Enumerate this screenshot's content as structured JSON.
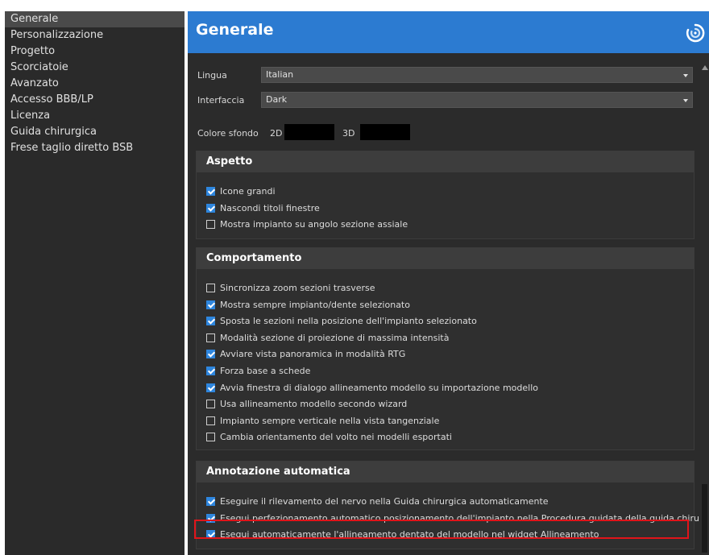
{
  "sidebar": {
    "items": [
      {
        "label": "Generale"
      },
      {
        "label": "Personalizzazione"
      },
      {
        "label": "Progetto"
      },
      {
        "label": "Scorciatoie"
      },
      {
        "label": "Avanzato"
      },
      {
        "label": "Accesso BBB/LP"
      },
      {
        "label": "Licenza"
      },
      {
        "label": "Guida chirurgica"
      },
      {
        "label": "Frese taglio diretto BSB"
      }
    ],
    "active_index": 0
  },
  "header": {
    "title": "Generale",
    "logo_icon": "swirl-logo-icon"
  },
  "settings": {
    "language_label": "Lingua",
    "language_value": "Italian",
    "interface_label": "Interfaccia",
    "interface_value": "Dark",
    "bg_color_label": "Colore sfondo",
    "bg_2d_label": "2D",
    "bg_3d_label": "3D",
    "bg_2d_color": "#000000",
    "bg_3d_color": "#000000"
  },
  "groups": {
    "aspetto": {
      "title": "Aspetto",
      "options": [
        {
          "label": "Icone grandi",
          "checked": true
        },
        {
          "label": "Nascondi titoli finestre",
          "checked": true
        },
        {
          "label": "Mostra impianto su angolo sezione assiale",
          "checked": false
        }
      ]
    },
    "comportamento": {
      "title": "Comportamento",
      "options": [
        {
          "label": "Sincronizza zoom sezioni trasverse",
          "checked": false
        },
        {
          "label": "Mostra sempre impianto/dente selezionato",
          "checked": true
        },
        {
          "label": "Sposta le sezioni nella posizione dell'impianto selezionato",
          "checked": true
        },
        {
          "label": "Modalità sezione di proiezione di massima intensità",
          "checked": false
        },
        {
          "label": "Avviare vista panoramica in modalità RTG",
          "checked": true
        },
        {
          "label": "Forza base a schede",
          "checked": true
        },
        {
          "label": "Avvia finestra di dialogo allineamento modello su importazione modello",
          "checked": true
        },
        {
          "label": "Usa allineamento modello secondo wizard",
          "checked": false
        },
        {
          "label": "Impianto sempre verticale nella vista tangenziale",
          "checked": false
        },
        {
          "label": "Cambia orientamento del volto nei modelli esportati",
          "checked": false
        }
      ]
    },
    "annotazione": {
      "title": "Annotazione automatica",
      "options": [
        {
          "label": "Eseguire il rilevamento del nervo nella Guida chirurgica automaticamente",
          "checked": true
        },
        {
          "label": "Esegui perfezionamento automatico posizionamento dell'impianto nella Procedura guidata della guida chirurgica",
          "checked": true
        },
        {
          "label": "Esegui automaticamente l'allineamento dentato del modello nel widget Allineamento",
          "checked": true
        }
      ]
    }
  },
  "colors": {
    "header_blue": "#2c7bd1",
    "checkbox_blue": "#2e86de",
    "highlight_red": "#e0141a",
    "panel_bg": "#2b2b2b"
  }
}
